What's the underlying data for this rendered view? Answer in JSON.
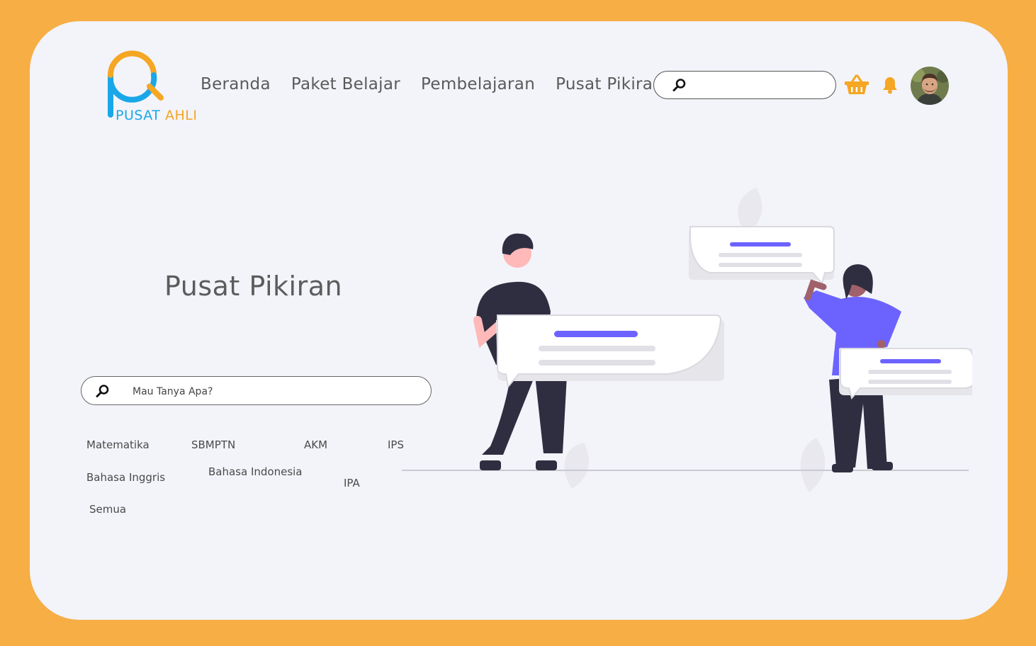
{
  "logo": {
    "word1": "PUSAT",
    "word2": "AHLI",
    "brand_blue": "#1aa7e8",
    "brand_orange": "#f5a623"
  },
  "nav": {
    "items": [
      {
        "label": "Beranda"
      },
      {
        "label": "Paket Belajar"
      },
      {
        "label": "Pembelajaran"
      },
      {
        "label": "Pusat Pikiran"
      }
    ]
  },
  "header": {
    "search_value": "",
    "icons": [
      "search-icon",
      "basket-icon",
      "bell-icon",
      "avatar"
    ]
  },
  "hero": {
    "title": "Pusat Pikiran",
    "search_placeholder": "Mau Tanya Apa?"
  },
  "tags": {
    "matematika": "Matematika",
    "sbmptn": "SBMPTN",
    "akm": "AKM",
    "ips": "IPS",
    "bahasa_inggris": "Bahasa Inggris",
    "bahasa_indonesia": "Bahasa Indonesia",
    "ipa": "IPA",
    "semua": "Semua"
  },
  "colors": {
    "frame": "#f6ae45",
    "card": "#f3f4fa",
    "accent": "#f5a623",
    "illustration_purple": "#6c63ff",
    "illustration_dark": "#2f2e41"
  }
}
